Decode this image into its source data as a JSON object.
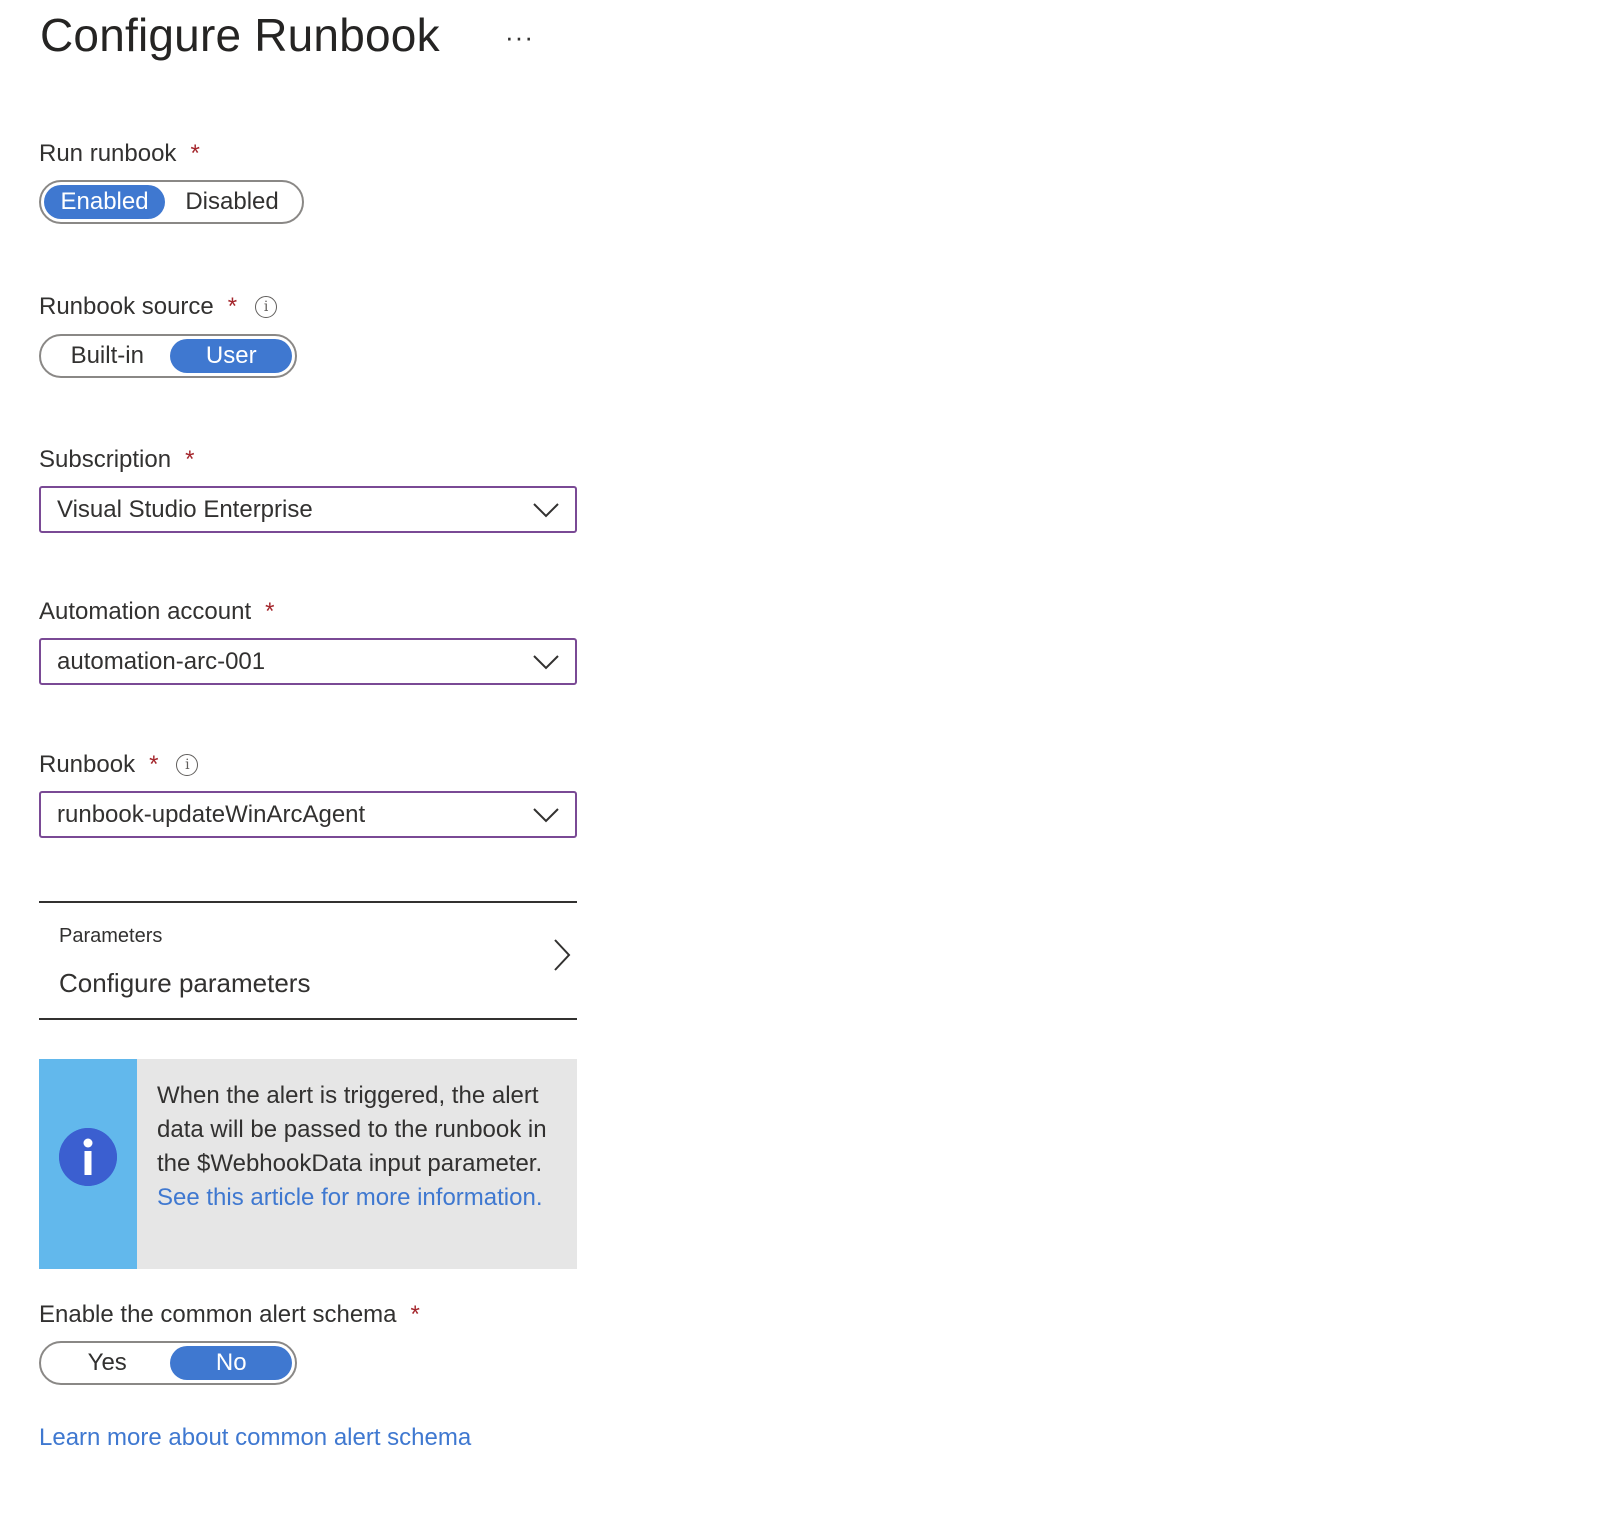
{
  "header": {
    "title": "Configure Runbook",
    "more_label": "···"
  },
  "run_runbook": {
    "label": "Run runbook",
    "required": "*",
    "options": [
      "Enabled",
      "Disabled"
    ],
    "selected": "Enabled"
  },
  "runbook_source": {
    "label": "Runbook source",
    "required": "*",
    "info_icon": "info-icon",
    "options": [
      "Built-in",
      "User"
    ],
    "selected": "User"
  },
  "subscription": {
    "label": "Subscription",
    "required": "*",
    "value": "Visual Studio Enterprise"
  },
  "automation_account": {
    "label": "Automation account",
    "required": "*",
    "value": "automation-arc-001"
  },
  "runbook": {
    "label": "Runbook",
    "required": "*",
    "info_icon": "info-icon",
    "value": "runbook-updateWinArcAgent"
  },
  "parameters": {
    "label": "Parameters",
    "action": "Configure parameters"
  },
  "info_box": {
    "text": "When the alert is triggered, the alert data will be passed to the runbook in the $WebhookData input parameter. ",
    "link": "See this article for more information.",
    "accent_color": "#62b8ec",
    "icon_color": "#3b5fd0"
  },
  "common_alert_schema": {
    "label": "Enable the common alert schema",
    "required": "*",
    "options": [
      "Yes",
      "No"
    ],
    "selected": "No",
    "learn_more": "Learn more about common alert schema"
  },
  "colors": {
    "accent": "#3f78d0",
    "required": "#a4262c",
    "select_border": "#7a4a95"
  }
}
